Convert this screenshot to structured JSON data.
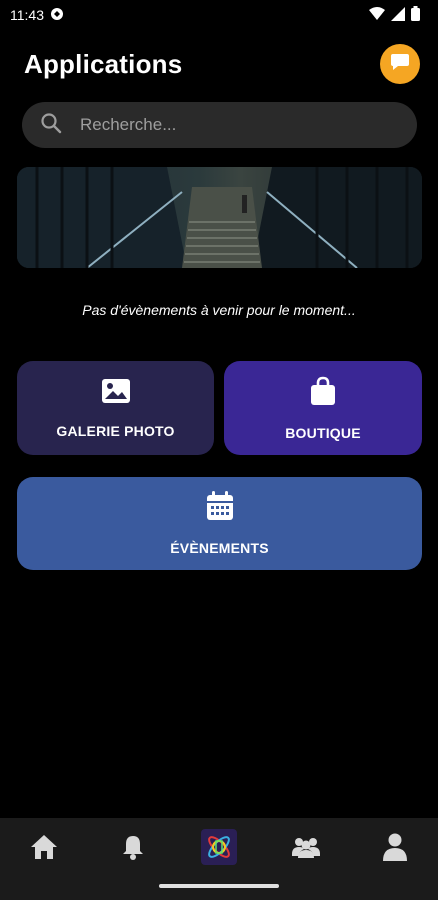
{
  "status_bar": {
    "time": "11:43",
    "icons": [
      "notification-icon",
      "wifi-icon",
      "signal-icon",
      "battery-icon"
    ]
  },
  "header": {
    "title": "Applications",
    "chat_icon": "chat-bubble-icon"
  },
  "search": {
    "placeholder": "Recherche...",
    "icon": "search-icon"
  },
  "banner": {
    "image": "stairway-photo"
  },
  "events_message": "Pas d'évènements à venir pour le moment...",
  "tiles": {
    "gallery": {
      "label": "GALERIE PHOTO",
      "icon": "image-icon"
    },
    "shop": {
      "label": "BOUTIQUE",
      "icon": "shopping-bag-icon"
    },
    "events": {
      "label": "ÉVÈNEMENTS",
      "icon": "calendar-icon"
    }
  },
  "bottom_nav": {
    "items": [
      "home-icon",
      "bell-icon",
      "app-logo-icon",
      "group-icon",
      "profile-icon"
    ]
  },
  "colors": {
    "background": "#000000",
    "accent": "#f5a623",
    "gallery_tile": "#28244e",
    "shop_tile": "#3a2795",
    "events_tile": "#3a5a9e"
  }
}
